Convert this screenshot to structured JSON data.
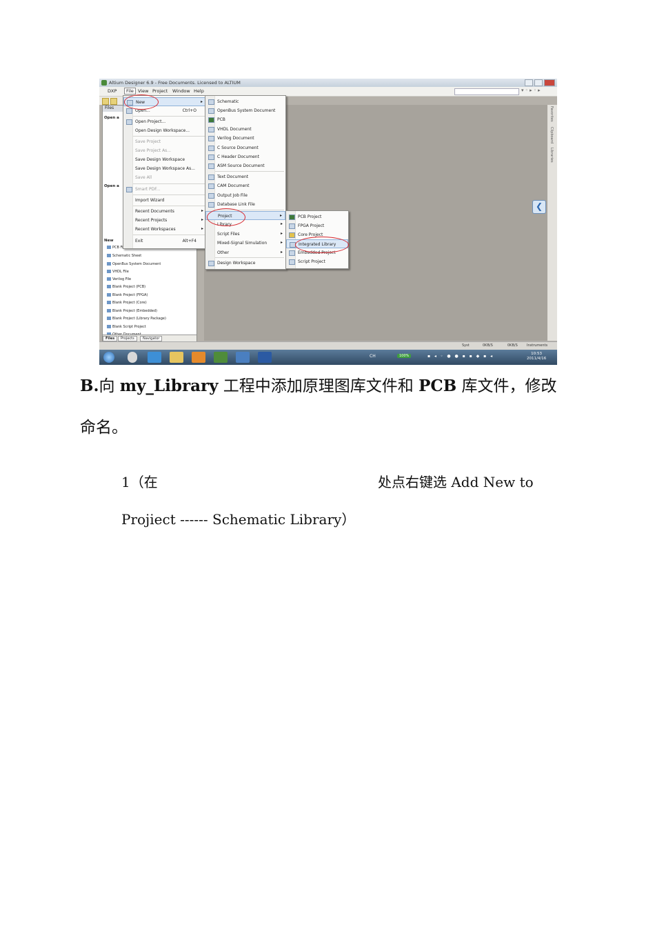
{
  "screenshot": {
    "title": "Altium Designer 6.9 - Free Documents. Licensed to ALTIUM",
    "menubar": [
      "DXP",
      "File",
      "View",
      "Project",
      "Window",
      "Help"
    ],
    "left_panel": {
      "header": "Files",
      "section_open": "Open a",
      "section_open2": "Open a",
      "section_new": "New",
      "new_items": [
        "PCB File",
        "Schematic Sheet",
        "OpenBus System Document",
        "VHDL File",
        "Verilog File",
        "Blank Project (PCB)",
        "Blank Project (FPGA)",
        "Blank Project (Core)",
        "Blank Project (Embedded)",
        "Blank Project (Library Package)",
        "Blank Script Project",
        "Other Document"
      ],
      "tabs": [
        "Files",
        "Projects",
        "Navigator"
      ]
    },
    "file_menu": [
      {
        "label": "New",
        "shortcut": "",
        "arrow": true,
        "highlight": true
      },
      {
        "label": "Open...",
        "shortcut": "Ctrl+O"
      },
      {
        "label": "Open Project..."
      },
      {
        "label": "Open Design Workspace..."
      },
      {
        "label": "Save Project",
        "disabled": true
      },
      {
        "label": "Save Project As...",
        "disabled": true
      },
      {
        "label": "Save Design Workspace"
      },
      {
        "label": "Save Design Workspace As..."
      },
      {
        "label": "Save All",
        "disabled": true
      },
      {
        "label": "Smart PDF...",
        "disabled": true
      },
      {
        "label": "Import Wizard"
      },
      {
        "label": "Recent Documents",
        "arrow": true
      },
      {
        "label": "Recent Projects",
        "arrow": true
      },
      {
        "label": "Recent Workspaces",
        "arrow": true
      },
      {
        "label": "Exit",
        "shortcut": "Alt+F4"
      }
    ],
    "new_menu": [
      {
        "label": "Schematic"
      },
      {
        "label": "OpenBus System Document"
      },
      {
        "label": "PCB"
      },
      {
        "label": "VHDL Document"
      },
      {
        "label": "Verilog Document"
      },
      {
        "label": "C Source Document"
      },
      {
        "label": "C Header Document"
      },
      {
        "label": "ASM Source Document"
      },
      {
        "label": "Text Document"
      },
      {
        "label": "CAM Document"
      },
      {
        "label": "Output Job File"
      },
      {
        "label": "Database Link File"
      },
      {
        "label": "Project",
        "arrow": true,
        "highlight": true
      },
      {
        "label": "Library",
        "arrow": true
      },
      {
        "label": "Script Files",
        "arrow": true
      },
      {
        "label": "Mixed-Signal Simulation",
        "arrow": true
      },
      {
        "label": "Other",
        "arrow": true
      },
      {
        "label": "Design Workspace"
      }
    ],
    "project_menu": [
      {
        "label": "PCB Project"
      },
      {
        "label": "FPGA Project"
      },
      {
        "label": "Core Project"
      },
      {
        "label": "Integrated Library",
        "highlight": true
      },
      {
        "label": "Embedded Project"
      },
      {
        "label": "Script Project"
      }
    ],
    "right_strip": [
      "Favorites",
      "Clipboard",
      "Libraries"
    ],
    "statusbar": [
      "Syst",
      "0KB/S",
      "0KB/S",
      "Instruments"
    ],
    "taskbar": {
      "zoom": "100%",
      "time": "10:53",
      "date": "2011/4/16",
      "ime": "CH"
    }
  },
  "document": {
    "heading_prefix": "B.",
    "heading_text1": "向 ",
    "heading_bold1": "my_Library",
    "heading_text2": " 工程中添加原理图库文件和 ",
    "heading_bold2": "PCB",
    "heading_text3": " 库文件，修改",
    "heading_line2": "命名。",
    "step_prefix": "1（在",
    "step_suffix": "处点右键选  Add New to",
    "step_line2": "Projiect ------    Schematic Library）"
  }
}
